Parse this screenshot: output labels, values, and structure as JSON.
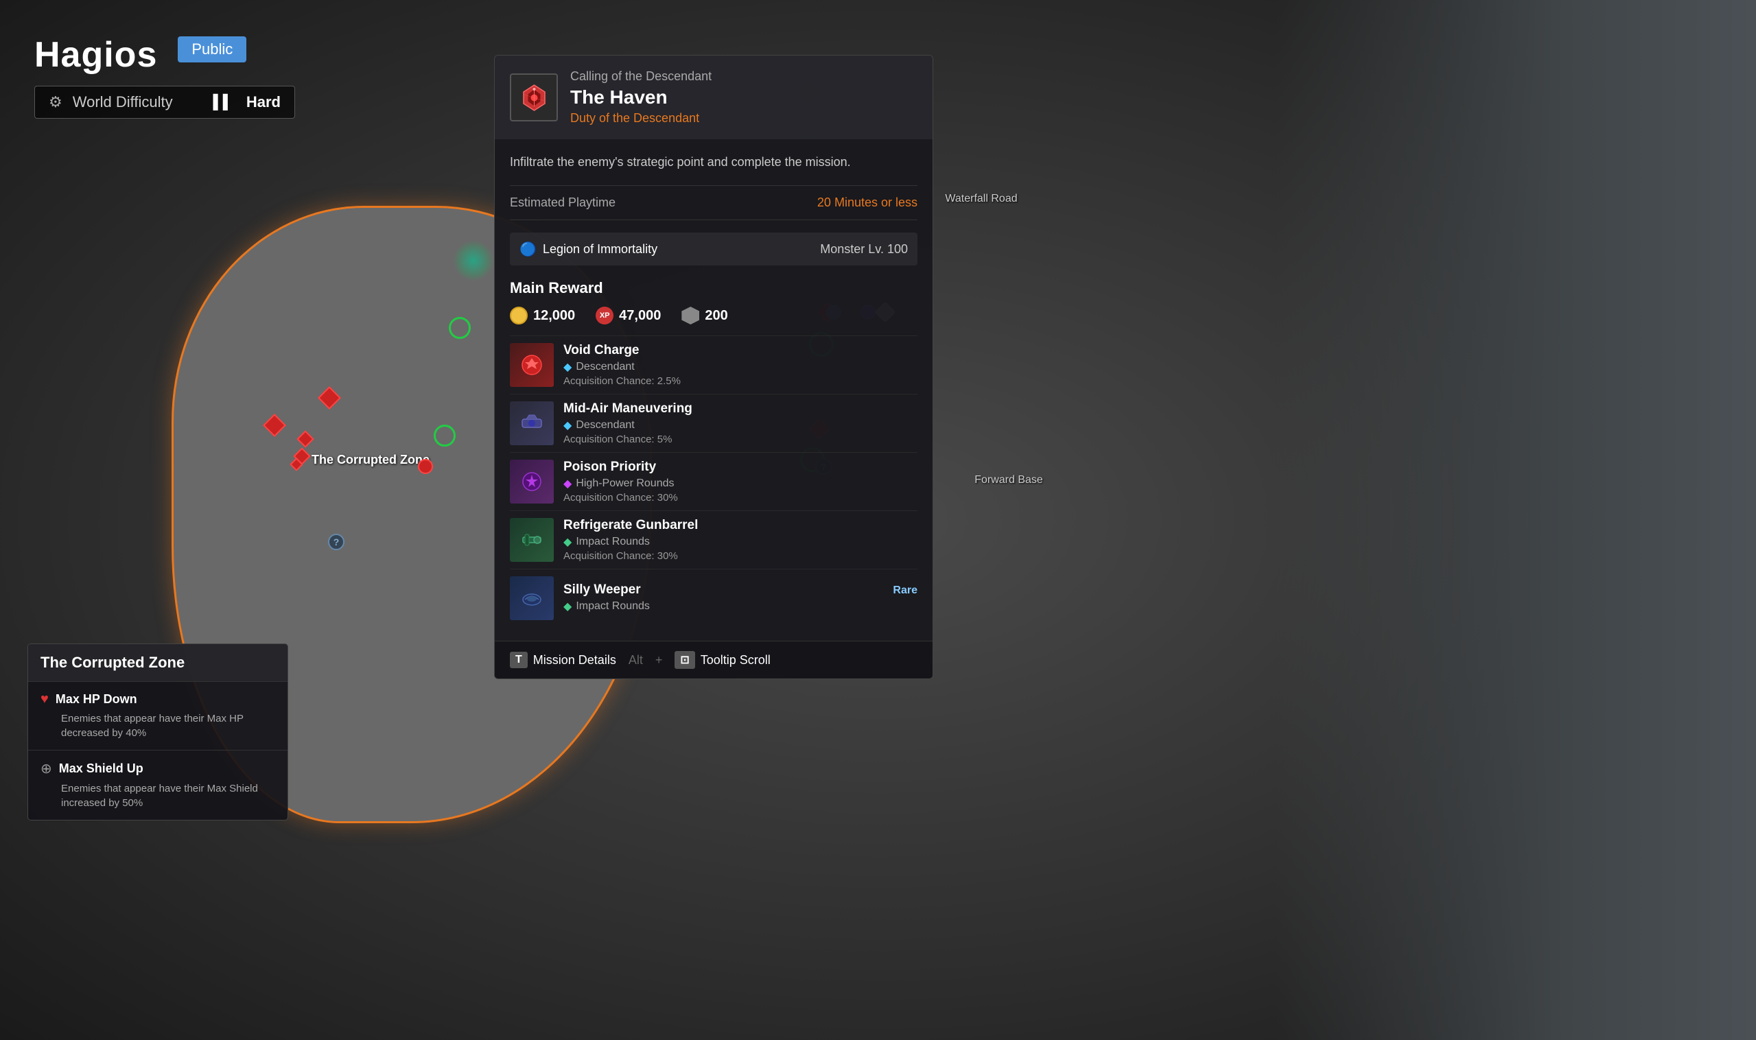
{
  "server": {
    "name": "Hagios",
    "visibility": "Public",
    "difficulty_label": "World Difficulty",
    "difficulty_value": "Hard"
  },
  "mission": {
    "category": "Calling of the Descendant",
    "name": "The Haven",
    "duty": "Duty of the Descendant",
    "description": "Infiltrate the enemy's strategic point and complete the mission.",
    "playtime_label": "Estimated Playtime",
    "playtime_value": "20 Minutes or less",
    "faction": "Legion of Immortality",
    "monster_level": "Monster Lv. 100",
    "reward_title": "Main Reward",
    "currencies": [
      {
        "type": "coin",
        "value": "12,000"
      },
      {
        "type": "xp",
        "value": "47,000"
      },
      {
        "type": "shield",
        "value": "200"
      }
    ],
    "rewards": [
      {
        "name": "Void Charge",
        "category": "Descendant",
        "chance": "Acquisition Chance: 2.5%",
        "thumb_class": "reward-thumb-red",
        "dot_class": "type-dot-blue",
        "rarity": ""
      },
      {
        "name": "Mid-Air Maneuvering",
        "category": "Descendant",
        "chance": "Acquisition Chance: 5%",
        "thumb_class": "reward-thumb-dark",
        "dot_class": "type-dot-blue",
        "rarity": ""
      },
      {
        "name": "Poison Priority",
        "category": "High-Power Rounds",
        "chance": "Acquisition Chance: 30%",
        "thumb_class": "reward-thumb-purple",
        "dot_class": "type-dot-purple",
        "rarity": ""
      },
      {
        "name": "Refrigerate Gunbarrel",
        "category": "Impact Rounds",
        "chance": "Acquisition Chance: 30%",
        "thumb_class": "reward-thumb-green",
        "dot_class": "type-dot-green",
        "rarity": ""
      },
      {
        "name": "Silly Weeper",
        "category": "Impact Rounds",
        "chance": "",
        "thumb_class": "reward-thumb-blue",
        "dot_class": "type-dot-green",
        "rarity": "Rare"
      }
    ],
    "footer": {
      "mission_details_key": "T",
      "mission_details_label": "Mission Details",
      "tooltip_scroll_key": "Alt",
      "tooltip_scroll_key2": "⊡",
      "tooltip_scroll_label": "Tooltip Scroll"
    }
  },
  "zone": {
    "title": "The Corrupted Zone",
    "effects": [
      {
        "icon_type": "heart",
        "name": "Max HP Down",
        "desc": "Enemies that appear have their Max HP decreased by 40%"
      },
      {
        "icon_type": "shield",
        "name": "Max Shield Up",
        "desc": "Enemies that appear have their Max Shield increased by 50%"
      }
    ]
  },
  "map": {
    "zone_label": "The Corrupted Zone",
    "road_label": "Waterfall Road",
    "forward_base_label": "Forward Base"
  }
}
